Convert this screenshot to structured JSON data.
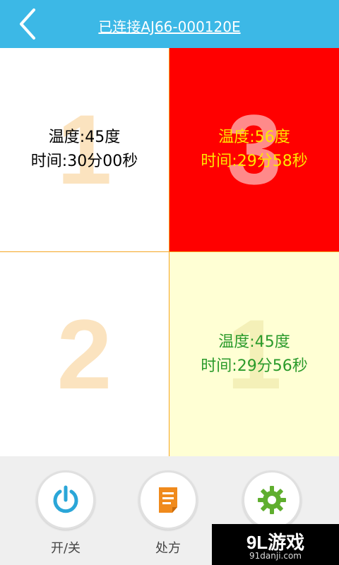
{
  "header": {
    "title": "已连接AJ66-000120E",
    "background": "#3cb8e6"
  },
  "cells": [
    {
      "number": "1",
      "temperature": "温度:45度",
      "time": "时间:30分00秒",
      "background": "#ffffff",
      "text_color": "#000000"
    },
    {
      "number": "3",
      "temperature": "温度:56度",
      "time": "时间:29分58秒",
      "background": "#ff0000",
      "text_color": "#ffe600"
    },
    {
      "number": "2",
      "temperature": "",
      "time": "",
      "background": "#ffffff",
      "text_color": "#000000"
    },
    {
      "number": "1",
      "temperature": "温度:45度",
      "time": "时间:29分56秒",
      "background": "#ffffd4",
      "text_color": "#2a9a2a"
    }
  ],
  "bottom_bar": {
    "actions": [
      {
        "label": "开/关",
        "icon": "power-icon",
        "color": "#2aa6d8"
      },
      {
        "label": "处方",
        "icon": "prescription-icon",
        "color": "#f08a1c"
      },
      {
        "label": "",
        "icon": "gear-icon",
        "color": "#5fae2e"
      }
    ]
  },
  "watermark": {
    "main": "9L游戏",
    "sub": "91danji.com"
  }
}
